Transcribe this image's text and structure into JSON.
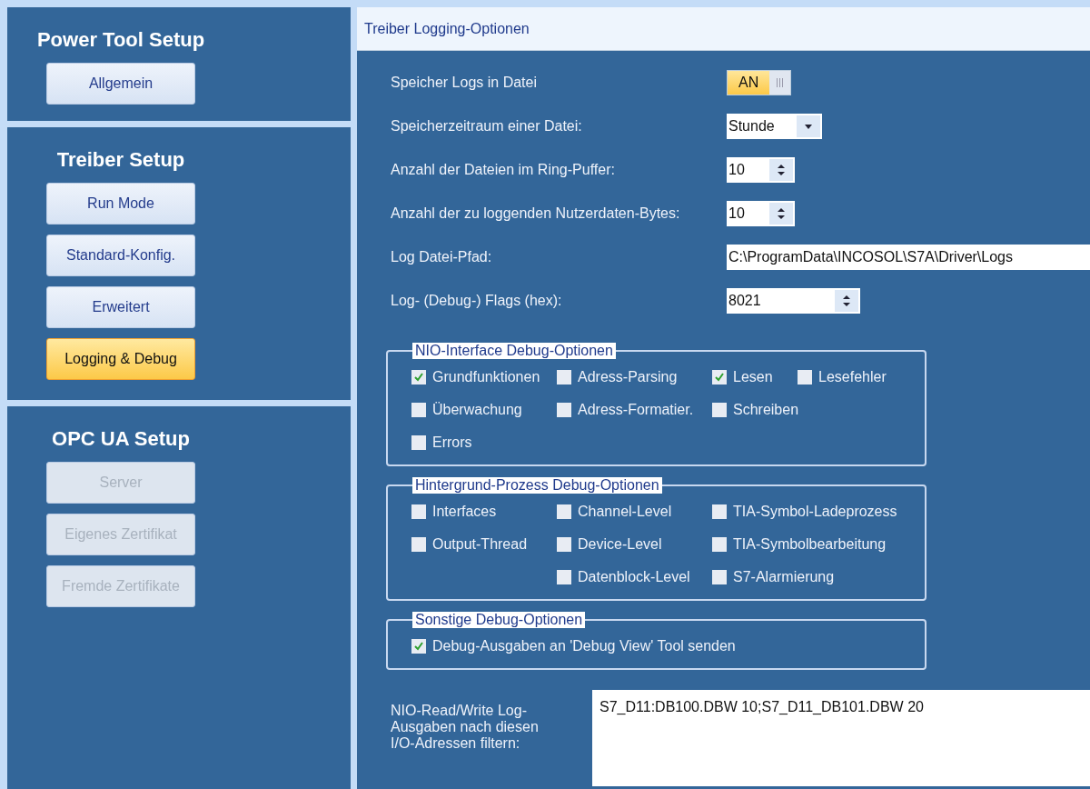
{
  "sidebar": {
    "sections": [
      {
        "title": "Power Tool Setup",
        "buttons": [
          {
            "label": "Allgemein",
            "selected": false,
            "disabled": false
          }
        ]
      },
      {
        "title": "Treiber Setup",
        "buttons": [
          {
            "label": "Run Mode",
            "selected": false,
            "disabled": false
          },
          {
            "label": "Standard-Konfig.",
            "selected": false,
            "disabled": false
          },
          {
            "label": "Erweitert",
            "selected": false,
            "disabled": false
          },
          {
            "label": "Logging & Debug",
            "selected": true,
            "disabled": false
          }
        ]
      },
      {
        "title": "OPC UA Setup",
        "buttons": [
          {
            "label": "Server",
            "selected": false,
            "disabled": true
          },
          {
            "label": "Eigenes Zertifikat",
            "selected": false,
            "disabled": true
          },
          {
            "label": "Fremde Zertifikate",
            "selected": false,
            "disabled": true
          }
        ]
      }
    ]
  },
  "panel": {
    "title": "Treiber Logging-Optionen",
    "fields": [
      {
        "kind": "toggle",
        "label": "Speicher Logs in Datei",
        "value": "AN",
        "on": true
      },
      {
        "kind": "dropdown",
        "label": "Speicherzeitraum einer Datei:",
        "value": "Stunde"
      },
      {
        "kind": "spinner",
        "label": "Anzahl der Dateien im Ring-Puffer:",
        "value": "10"
      },
      {
        "kind": "spinner",
        "label": "Anzahl der zu loggenden Nutzerdaten-Bytes:",
        "value": "10"
      },
      {
        "kind": "text",
        "label": "Log Datei-Pfad:",
        "value": "C:\\ProgramData\\INCOSOL\\S7A\\Driver\\Logs"
      },
      {
        "kind": "wide-spinner",
        "label": "Log- (Debug-) Flags (hex):",
        "value": "8021"
      }
    ],
    "groups": [
      {
        "title": "NIO-Interface Debug-Optionen",
        "columns": [
          [
            {
              "label": "Grundfunktionen",
              "checked": true
            },
            {
              "label": "Überwachung",
              "checked": false
            },
            {
              "label": "Errors",
              "checked": false
            }
          ],
          [
            {
              "label": "Adress-Parsing",
              "checked": false
            },
            {
              "label": "Adress-Formatier.",
              "checked": false
            }
          ],
          [
            {
              "label": "Lesen",
              "checked": true
            },
            {
              "label": "Schreiben",
              "checked": false
            }
          ],
          [
            {
              "label": "Lesefehler",
              "checked": false
            }
          ]
        ]
      },
      {
        "title": "Hintergrund-Prozess Debug-Optionen",
        "columns": [
          [
            {
              "label": "Interfaces",
              "checked": false
            },
            {
              "label": "Output-Thread",
              "checked": false
            }
          ],
          [
            {
              "label": "Channel-Level",
              "checked": false
            },
            {
              "label": "Device-Level",
              "checked": false
            },
            {
              "label": "Datenblock-Level",
              "checked": false
            }
          ],
          [
            {
              "label": "TIA-Symbol-Ladeprozess",
              "checked": false
            },
            {
              "label": "TIA-Symbolbearbeitung",
              "checked": false
            },
            {
              "label": "S7-Alarmierung",
              "checked": false
            }
          ]
        ]
      },
      {
        "title": "Sonstige Debug-Optionen",
        "columns": [
          [
            {
              "label": "Debug-Ausgaben an 'Debug View' Tool senden",
              "checked": true
            }
          ]
        ]
      }
    ],
    "filter": {
      "label": "NIO-Read/Write Log-Ausgaben nach diesen I/O-Adressen filtern:",
      "value": "S7_D11:DB100.DBW 10;S7_D11_DB101.DBW 20"
    }
  }
}
